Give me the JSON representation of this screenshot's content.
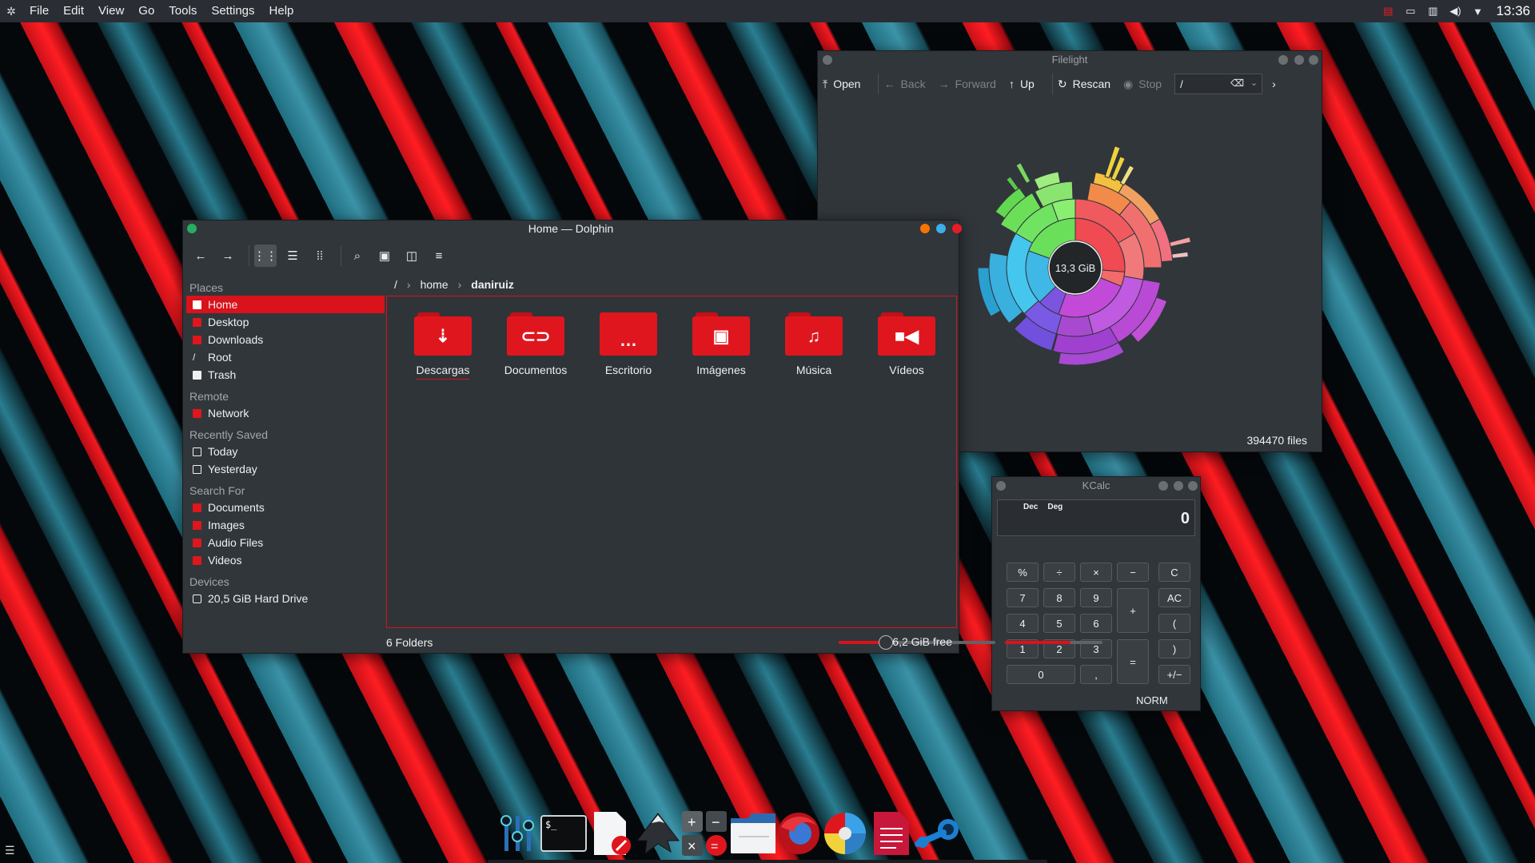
{
  "topbar": {
    "launcher_icon": "kde-launcher-icon",
    "menus": [
      "File",
      "Edit",
      "View",
      "Go",
      "Tools",
      "Settings",
      "Help"
    ],
    "tray_icons": [
      "notification-icon",
      "screen-icon",
      "clipboard-icon",
      "volume-icon",
      "expand-arrow-icon"
    ],
    "clock": "13:36"
  },
  "dolphin": {
    "title": "Home — Dolphin",
    "places": {
      "sections": [
        {
          "title": "Places",
          "items": [
            "Home",
            "Desktop",
            "Downloads",
            "Root",
            "Trash"
          ]
        },
        {
          "title": "Remote",
          "items": [
            "Network"
          ]
        },
        {
          "title": "Recently Saved",
          "items": [
            "Today",
            "Yesterday"
          ]
        },
        {
          "title": "Search For",
          "items": [
            "Documents",
            "Images",
            "Audio Files",
            "Videos"
          ]
        },
        {
          "title": "Devices",
          "items": [
            "20,5 GiB Hard Drive"
          ]
        }
      ]
    },
    "breadcrumb": [
      "/",
      "home",
      "daniruiz"
    ],
    "folders": [
      "Descargas",
      "Documentos",
      "Escritorio",
      "Imágenes",
      "Música",
      "Vídeos"
    ],
    "status": "6 Folders",
    "free": "6,2 GiB free",
    "zoom_level": 0.3,
    "disk_used_fraction": 0.67
  },
  "filelight": {
    "title": "Filelight",
    "toolbar": {
      "open": "Open",
      "back": "Back",
      "forward": "Forward",
      "up": "Up",
      "rescan": "Rescan",
      "stop": "Stop"
    },
    "path": "/",
    "center_label": "13,3 GiB",
    "status": "394470 files"
  },
  "kcalc": {
    "title": "KCalc",
    "modes": [
      "Dec",
      "Deg"
    ],
    "display": "0",
    "keys": [
      "%",
      "÷",
      "×",
      "−",
      "C",
      "7",
      "8",
      "9",
      "+",
      "AC",
      "4",
      "5",
      "6",
      "(",
      "1",
      "2",
      "3",
      "=",
      ")",
      "0",
      ",",
      "+/−"
    ],
    "mode_label": "NORM"
  },
  "dock": {
    "apps": [
      "mixer-icon",
      "terminal-icon",
      "text-editor-icon",
      "inkscape-icon",
      "calculator-icon",
      "file-manager-icon",
      "firefox-icon",
      "filelight-icon",
      "document-viewer-icon",
      "steam-icon"
    ]
  },
  "colors": {
    "accent": "#d9121b",
    "window": "#31363b",
    "panel": "#2a2e34"
  }
}
